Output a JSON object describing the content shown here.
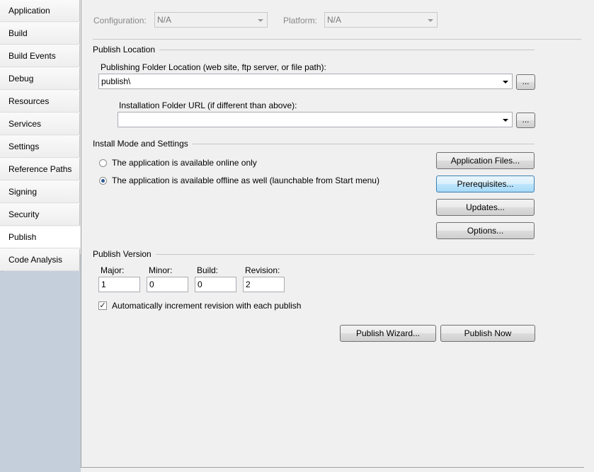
{
  "sidebar": {
    "tabs": [
      {
        "label": "Application",
        "id": "application"
      },
      {
        "label": "Build",
        "id": "build"
      },
      {
        "label": "Build Events",
        "id": "build-events"
      },
      {
        "label": "Debug",
        "id": "debug"
      },
      {
        "label": "Resources",
        "id": "resources"
      },
      {
        "label": "Services",
        "id": "services"
      },
      {
        "label": "Settings",
        "id": "settings"
      },
      {
        "label": "Reference Paths",
        "id": "reference-paths"
      },
      {
        "label": "Signing",
        "id": "signing"
      },
      {
        "label": "Security",
        "id": "security"
      },
      {
        "label": "Publish",
        "id": "publish",
        "active": true
      },
      {
        "label": "Code Analysis",
        "id": "code-analysis"
      }
    ]
  },
  "config": {
    "configuration_label": "Configuration:",
    "configuration_value": "N/A",
    "platform_label": "Platform:",
    "platform_value": "N/A"
  },
  "publish_location": {
    "title": "Publish Location",
    "folder_label": "Publishing Folder Location (web site, ftp server, or file path):",
    "folder_value": "publish\\",
    "install_label": "Installation Folder URL (if different than above):",
    "install_value": "",
    "browse_label": "..."
  },
  "install_mode": {
    "title": "Install Mode and Settings",
    "online_label": "The application is available online only",
    "offline_label": "The application is available offline as well (launchable from Start menu)",
    "buttons": {
      "app_files": "Application Files...",
      "prerequisites": "Prerequisites...",
      "updates": "Updates...",
      "options": "Options..."
    }
  },
  "publish_version": {
    "title": "Publish Version",
    "major_label": "Major:",
    "major_value": "1",
    "minor_label": "Minor:",
    "minor_value": "0",
    "build_label": "Build:",
    "build_value": "0",
    "revision_label": "Revision:",
    "revision_value": "2",
    "auto_increment_label": "Automatically increment revision with each publish",
    "auto_increment_checked": true
  },
  "actions": {
    "wizard": "Publish Wizard...",
    "now": "Publish Now"
  },
  "colors": {
    "sidebar_bg": "#c5cfdb",
    "focus_border": "#3c7fb1"
  }
}
